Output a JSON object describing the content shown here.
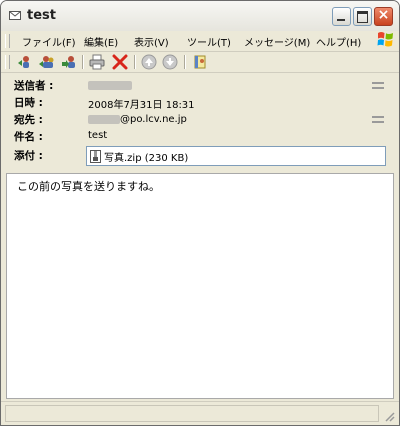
{
  "window": {
    "title": "test"
  },
  "menu": {
    "items": [
      {
        "label": "ファイル(F)"
      },
      {
        "label": "編集(E)"
      },
      {
        "label": "表示(V)"
      },
      {
        "label": "ツール(T)"
      },
      {
        "label": "メッセージ(M)"
      },
      {
        "label": "ヘルプ(H)"
      }
    ]
  },
  "toolbar": {
    "buttons": [
      {
        "icon": "reply-icon"
      },
      {
        "icon": "reply-all-icon"
      },
      {
        "icon": "forward-icon"
      },
      {
        "icon": "print-icon"
      },
      {
        "icon": "delete-icon"
      },
      {
        "icon": "previous-icon"
      },
      {
        "icon": "next-icon"
      },
      {
        "icon": "address-book-icon"
      }
    ]
  },
  "header": {
    "from_label": "送信者 :",
    "from_value": "",
    "date_label": "日時 :",
    "date_value": "2008年7月31日 18:31",
    "to_label": "宛先 :",
    "to_value": "@po.lcv.ne.jp",
    "subject_label": "件名 :",
    "subject_value": "test",
    "attach_label": "添付 :",
    "attachment": "写真.zip (230 KB)"
  },
  "body": {
    "text": "この前の写真を送りますね。"
  },
  "colors": {
    "window_bg": "#ece9d8",
    "close_button": "#c8421f",
    "border_blue": "#7f9db9"
  }
}
